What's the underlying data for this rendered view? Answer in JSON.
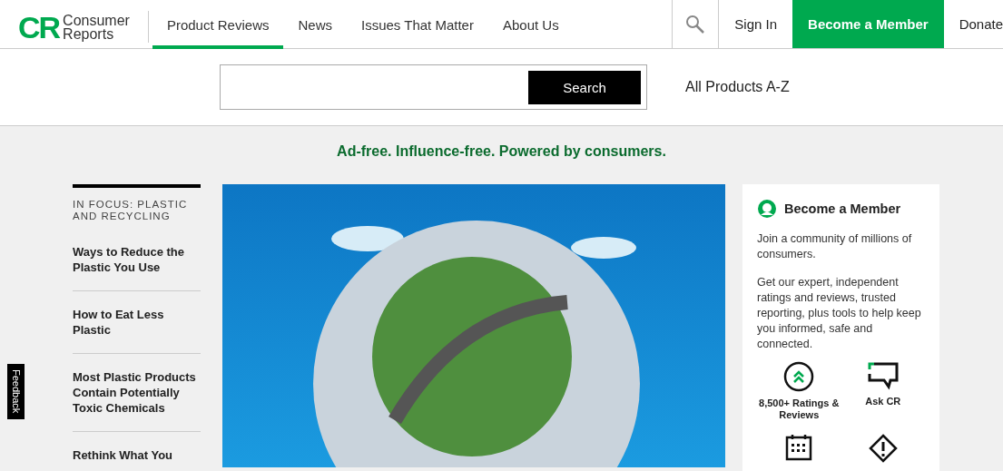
{
  "header": {
    "logo": {
      "mark": "CR",
      "name_line_1": "Consumer",
      "name_line_2": "Reports"
    },
    "nav": [
      {
        "label": "Product Reviews",
        "selected": true
      },
      {
        "label": "News",
        "selected": false
      },
      {
        "label": "Issues That Matter",
        "selected": false
      },
      {
        "label": "About Us",
        "selected": false
      }
    ],
    "sign_in": "Sign In",
    "member_button": "Become a Member",
    "donate": "Donate"
  },
  "search": {
    "button": "Search",
    "all_products": "All Products A-Z"
  },
  "tagline": "Ad-free. Influence-free. Powered by consumers.",
  "sidebar": {
    "heading": "IN FOCUS: PLASTIC AND RECYCLING",
    "items": [
      "Ways to Reduce the Plastic You Use",
      "How to Eat Less Plastic",
      "Most Plastic Products Contain Potentially Toxic Chemicals",
      "Rethink What You"
    ]
  },
  "feedback": "Feedback",
  "member_card": {
    "title": "Become a Member",
    "paragraphs": [
      "Join a community of millions of consumers.",
      "Get our expert, independent ratings and reviews, trusted reporting, plus tools to help keep you informed, safe and connected."
    ],
    "features": [
      {
        "kind": "ratings",
        "label": "8,500+ Ratings & Reviews"
      },
      {
        "kind": "ask",
        "label": "Ask CR"
      },
      {
        "kind": "calendar"
      },
      {
        "kind": "alert"
      }
    ]
  }
}
